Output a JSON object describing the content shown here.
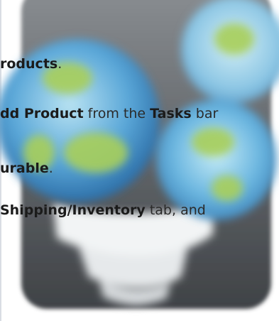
{
  "icon": "globe-world-icon",
  "lines": [
    {
      "parts": [
        {
          "t": "roducts",
          "b": true
        },
        {
          "t": ".",
          "b": false
        }
      ]
    },
    {
      "parts": [
        {
          "t": "dd Product",
          "b": true
        },
        {
          "t": " from the ",
          "b": false
        },
        {
          "t": "Tasks",
          "b": true
        },
        {
          "t": " bar",
          "b": false
        }
      ]
    },
    {
      "parts": [
        {
          "t": "urable",
          "b": true
        },
        {
          "t": ".",
          "b": false
        }
      ]
    },
    {
      "parts": [
        {
          "t": "Shipping/Inventory",
          "b": true
        },
        {
          "t": " tab, and",
          "b": false
        }
      ]
    }
  ]
}
